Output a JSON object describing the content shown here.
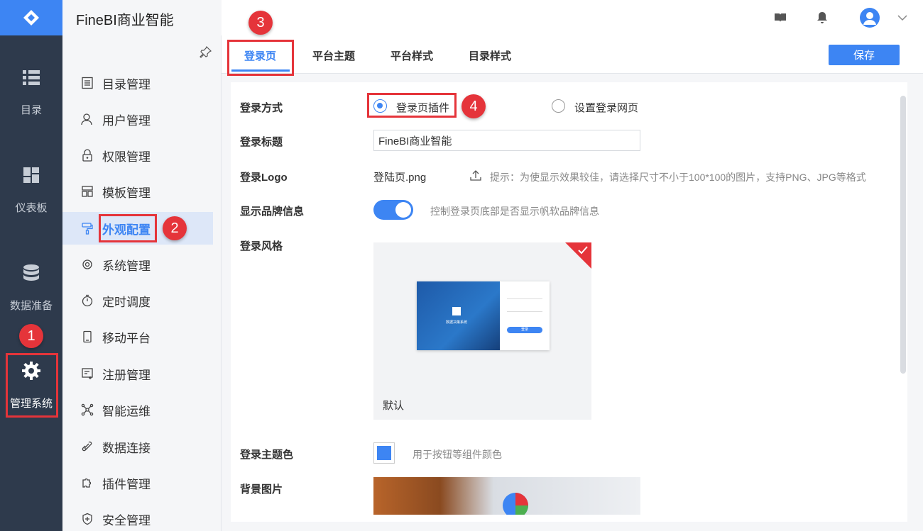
{
  "app": {
    "title": "FineBI商业智能"
  },
  "rail": {
    "items": [
      {
        "label": "目录",
        "icon": "list-icon"
      },
      {
        "label": "仪表板",
        "icon": "dashboard-icon"
      },
      {
        "label": "数据准备",
        "icon": "database-icon"
      },
      {
        "label": "管理系统",
        "icon": "gear-icon",
        "active": true
      }
    ]
  },
  "subnav": {
    "items": [
      {
        "label": "目录管理",
        "icon": "catalog-icon"
      },
      {
        "label": "用户管理",
        "icon": "user-icon"
      },
      {
        "label": "权限管理",
        "icon": "lock-icon"
      },
      {
        "label": "模板管理",
        "icon": "template-icon"
      },
      {
        "label": "外观配置",
        "icon": "paint-roller-icon",
        "active": true
      },
      {
        "label": "系统管理",
        "icon": "gear-icon"
      },
      {
        "label": "定时调度",
        "icon": "timer-icon"
      },
      {
        "label": "移动平台",
        "icon": "mobile-icon"
      },
      {
        "label": "注册管理",
        "icon": "register-icon"
      },
      {
        "label": "智能运维",
        "icon": "network-icon"
      },
      {
        "label": "数据连接",
        "icon": "link-icon"
      },
      {
        "label": "插件管理",
        "icon": "puzzle-icon"
      },
      {
        "label": "安全管理",
        "icon": "shield-icon"
      }
    ]
  },
  "tabs": [
    {
      "label": "登录页",
      "active": true
    },
    {
      "label": "平台主题"
    },
    {
      "label": "平台样式"
    },
    {
      "label": "目录样式"
    }
  ],
  "toolbar": {
    "save_label": "保存"
  },
  "form": {
    "login_method": {
      "label": "登录方式",
      "options": [
        "登录页插件",
        "设置登录网页"
      ],
      "selected": "登录页插件"
    },
    "login_title": {
      "label": "登录标题",
      "value": "FineBI商业智能"
    },
    "login_logo": {
      "label": "登录Logo",
      "file": "登陆页.png",
      "hint": "提示：为使显示效果较佳，请选择尺寸不小于100*100的图片，支持PNG、JPG等格式"
    },
    "brand_info": {
      "label": "显示品牌信息",
      "enabled": true,
      "hint": "控制登录页底部是否显示帆软品牌信息"
    },
    "login_style": {
      "label": "登录风格",
      "card_caption": "默认",
      "preview_text": "数据决策系统",
      "preview_button": "登录"
    },
    "theme_color": {
      "label": "登录主题色",
      "color": "#3d85f3",
      "hint": "用于按钮等组件颜色"
    },
    "background": {
      "label": "背景图片"
    }
  },
  "annotations": [
    "1",
    "2",
    "3",
    "4"
  ],
  "colors": {
    "accent": "#3d85f3",
    "annotation": "#e5343a",
    "rail": "#2e3a4c"
  }
}
